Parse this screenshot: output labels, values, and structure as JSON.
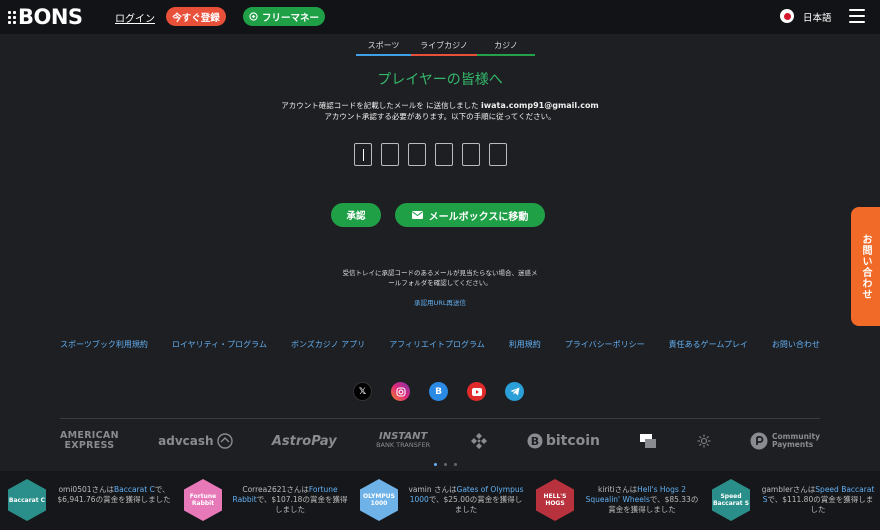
{
  "header": {
    "logo_text": "BONS",
    "login_label": "ログイン",
    "register_label": "今すぐ登録",
    "free_money_label": "フリーマネー",
    "language_label": "日本語",
    "free_money_icon": "coin-icon"
  },
  "tabs": [
    {
      "label": "スポーツ",
      "color": "#3fa0e6"
    },
    {
      "label": "ライブカジノ",
      "color": "#e8503a"
    },
    {
      "label": "カジノ",
      "color": "#25a14a"
    }
  ],
  "main": {
    "heading": "プレイヤーの皆様へ",
    "message_line1_prefix": "アカウント確認コードを記載したメールを に送信しました",
    "email": "iwata.comp91@gmail.com",
    "message_line2": "アカウント承認する必要があります。以下の手順に従ってください。",
    "confirm_label": "承認",
    "mailbox_label": "メールボックスに移動",
    "help_line1": "受信トレイに承認コードのあるメールが見当たらない場合、迷惑メ",
    "help_line2": "ールフォルダを確認してください。",
    "resend_label": "承認用URL再送信"
  },
  "footer": {
    "links": [
      "スポーツブック利用規約",
      "ロイヤリティ・プログラム",
      "ボンズカジノ アプリ",
      "アフィリエイトプログラム",
      "利用規約",
      "プライバシーポリシー",
      "責任あるゲームプレイ",
      "お問い合わせ"
    ],
    "social": [
      "x-icon",
      "instagram-icon",
      "bons-icon",
      "youtube-icon",
      "telegram-icon"
    ],
    "payments": {
      "amex_line1": "AMERICAN",
      "amex_line2": "EXPRESS",
      "advcash": "advcash",
      "astropay": "AstroPay",
      "instant_line1": "INSTANT",
      "instant_line2": "BANK TRANSFER",
      "bitcoin": "bitcoin",
      "community_line1": "Community",
      "community_line2": "Payments"
    }
  },
  "contact_tab_label": "お問い合わせ",
  "feed": [
    {
      "user": "omi0501さんは",
      "game": "Baccarat C",
      "text": "で、$6,941.76の賞金を獲得しました",
      "thumb_label": "Baccarat C",
      "thumb_color": "#2a8f8a"
    },
    {
      "user": "Correa2621さんは",
      "game": "Fortune Rabbit",
      "text": "で、$107.18の賞金を獲得しました",
      "thumb_label": "Fortune Rabbit",
      "thumb_color": "#e879b9"
    },
    {
      "user": "vamin さんは",
      "game": "Gates of Olympus 1000",
      "text": "で、$25.00の賞金を獲得しました",
      "thumb_label": "OLYMPUS 1000",
      "thumb_color": "#6fb2e8"
    },
    {
      "user": "kiritiさんは",
      "game": "Hell's Hogs 2 Squealin' Wheels",
      "text": "で、$85.33の賞金を獲得しました",
      "thumb_label": "HELL'S HOGS",
      "thumb_color": "#b8323d"
    },
    {
      "user": "gamblerさんは",
      "game": "Speed Baccarat S",
      "text": "で、$111.80の賞金を獲得しました",
      "thumb_label": "Speed Baccarat S",
      "thumb_color": "#2a8f8a"
    }
  ]
}
